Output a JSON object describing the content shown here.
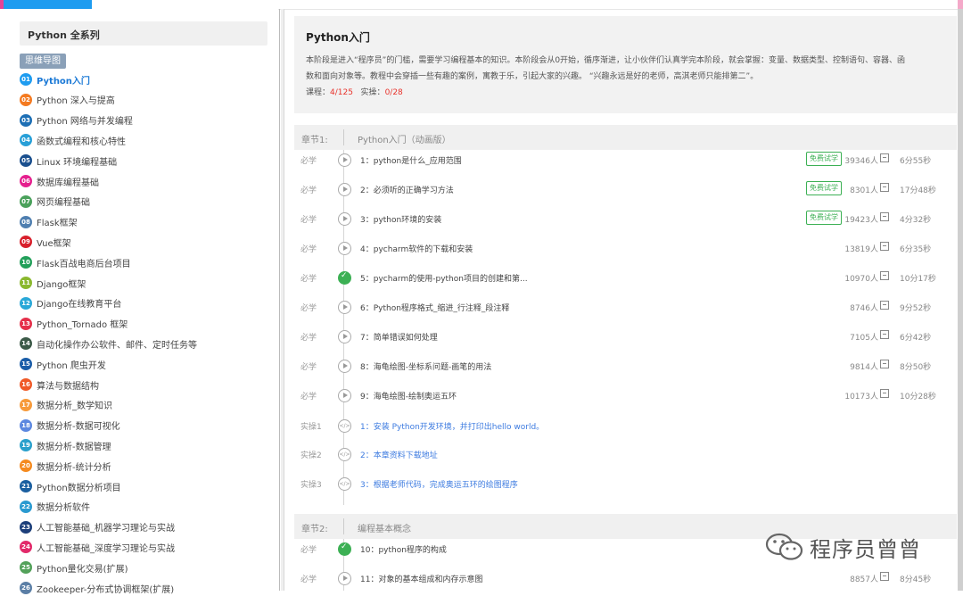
{
  "sidebar": {
    "header": "Python 全系列",
    "mindmap_button": "思维导图",
    "items": [
      {
        "num": "01",
        "label": "Python入门",
        "color": "#1e9cf0",
        "active": true
      },
      {
        "num": "02",
        "label": "Python 深入与提高",
        "color": "#f47a20"
      },
      {
        "num": "03",
        "label": "Python 网络与并发编程",
        "color": "#1d6fb5"
      },
      {
        "num": "04",
        "label": "函数式编程和核心特性",
        "color": "#29a0d8"
      },
      {
        "num": "05",
        "label": "Linux 环境编程基础",
        "color": "#1a4f8e"
      },
      {
        "num": "06",
        "label": "数据库编程基础",
        "color": "#e5208e"
      },
      {
        "num": "07",
        "label": "网页编程基础",
        "color": "#4aa15b"
      },
      {
        "num": "08",
        "label": "Flask框架",
        "color": "#4f7fb0"
      },
      {
        "num": "09",
        "label": "Vue框架",
        "color": "#d8202c"
      },
      {
        "num": "10",
        "label": "Flask百战电商后台项目",
        "color": "#23a05a"
      },
      {
        "num": "11",
        "label": "Django框架",
        "color": "#8ab82e"
      },
      {
        "num": "12",
        "label": "Django在线教育平台",
        "color": "#2aa8d8"
      },
      {
        "num": "13",
        "label": "Python_Tornado 框架",
        "color": "#e5304a"
      },
      {
        "num": "14",
        "label": "自动化操作办公软件、邮件、定时任务等",
        "color": "#3c5a48"
      },
      {
        "num": "15",
        "label": "Python 爬虫开发",
        "color": "#1a5da8"
      },
      {
        "num": "16",
        "label": "算法与数据结构",
        "color": "#f05a28"
      },
      {
        "num": "17",
        "label": "数据分析_数学知识",
        "color": "#f79a3a"
      },
      {
        "num": "18",
        "label": "数据分析-数据可视化",
        "color": "#5c88e0"
      },
      {
        "num": "19",
        "label": "数据分析-数据管理",
        "color": "#2aa0cc"
      },
      {
        "num": "20",
        "label": "数据分析-统计分析",
        "color": "#f58a1f"
      },
      {
        "num": "21",
        "label": "Python数据分析项目",
        "color": "#1b5fa0"
      },
      {
        "num": "22",
        "label": "数据分析软件",
        "color": "#2a9ad0"
      },
      {
        "num": "23",
        "label": "人工智能基础_机器学习理论与实战",
        "color": "#1d3f7a"
      },
      {
        "num": "24",
        "label": "人工智能基础_深度学习理论与实战",
        "color": "#e22a6a"
      },
      {
        "num": "25",
        "label": "Python量化交易(扩展)",
        "color": "#53a15a"
      },
      {
        "num": "26",
        "label": "Zookeeper-分布式协调框架(扩展)",
        "color": "#5b7fa6"
      }
    ]
  },
  "intro": {
    "title": "Python入门",
    "desc_line1": "本阶段是进入“程序员”的门槛，需要学习编程基本的知识。本阶段会从0开始，循序渐进，让小伙伴们认真学完本阶段，就会掌握：变量、数据类型、控制语句、容器、函",
    "desc_line2": "数和面向对象等。教程中会穿插一些有趣的案例，寓教于乐，引起大家的兴趣。 “兴趣永远是好的老师，高淇老师只能排第二”。",
    "course_label": "课程：",
    "course_value": "4/125",
    "practice_label": "实操：",
    "practice_value": "0/28"
  },
  "chapters": [
    {
      "label": "章节1:",
      "title": "Python入门（动画版）"
    },
    {
      "label": "章节2:",
      "title": "编程基本概念"
    }
  ],
  "lessons": [
    {
      "tag": "必学",
      "title": "1：python是什么_应用范围",
      "free": "免费试学",
      "count": "39346人",
      "dur": "6分55秒",
      "state": "play"
    },
    {
      "tag": "必学",
      "title": "2：必须听的正确学习方法",
      "free": "免费试学",
      "count": "8301人",
      "dur": "17分48秒",
      "state": "play"
    },
    {
      "tag": "必学",
      "title": "3：python环境的安装",
      "free": "免费试学",
      "count": "19423人",
      "dur": "4分32秒",
      "state": "play"
    },
    {
      "tag": "必学",
      "title": "4：pycharm软件的下载和安装",
      "count": "13819人",
      "dur": "6分35秒",
      "state": "play"
    },
    {
      "tag": "必学",
      "title": "5：pycharm的使用-python项目的创建和第...",
      "count": "10970人",
      "dur": "10分17秒",
      "state": "done"
    },
    {
      "tag": "必学",
      "title": "6：Python程序格式_缩进_行注释_段注释",
      "count": "8746人",
      "dur": "9分52秒",
      "state": "play"
    },
    {
      "tag": "必学",
      "title": "7：简单错误如何处理",
      "count": "7105人",
      "dur": "6分42秒",
      "state": "play"
    },
    {
      "tag": "必学",
      "title": "8：海龟绘图-坐标系问题-画笔的用法",
      "count": "9814人",
      "dur": "8分50秒",
      "state": "play"
    },
    {
      "tag": "必学",
      "title": "9：海龟绘图-绘制奥运五环",
      "count": "10173人",
      "dur": "10分28秒",
      "state": "play"
    },
    {
      "tag": "实操1",
      "title": "1：安装 Python开发环境，并打印出hello world。",
      "state": "code"
    },
    {
      "tag": "实操2",
      "title": "2：本章资料下载地址",
      "state": "code"
    },
    {
      "tag": "实操3",
      "title": "3：根据老师代码，完成奥运五环的绘图程序",
      "state": "code"
    },
    {
      "tag": "必学",
      "title": "10：python程序的构成",
      "state": "done"
    },
    {
      "tag": "必学",
      "title": "11：对象的基本组成和内存示意图",
      "count": "8857人",
      "dur": "8分45秒",
      "state": "play"
    }
  ],
  "watermark": {
    "text": "程序员曾曾"
  }
}
